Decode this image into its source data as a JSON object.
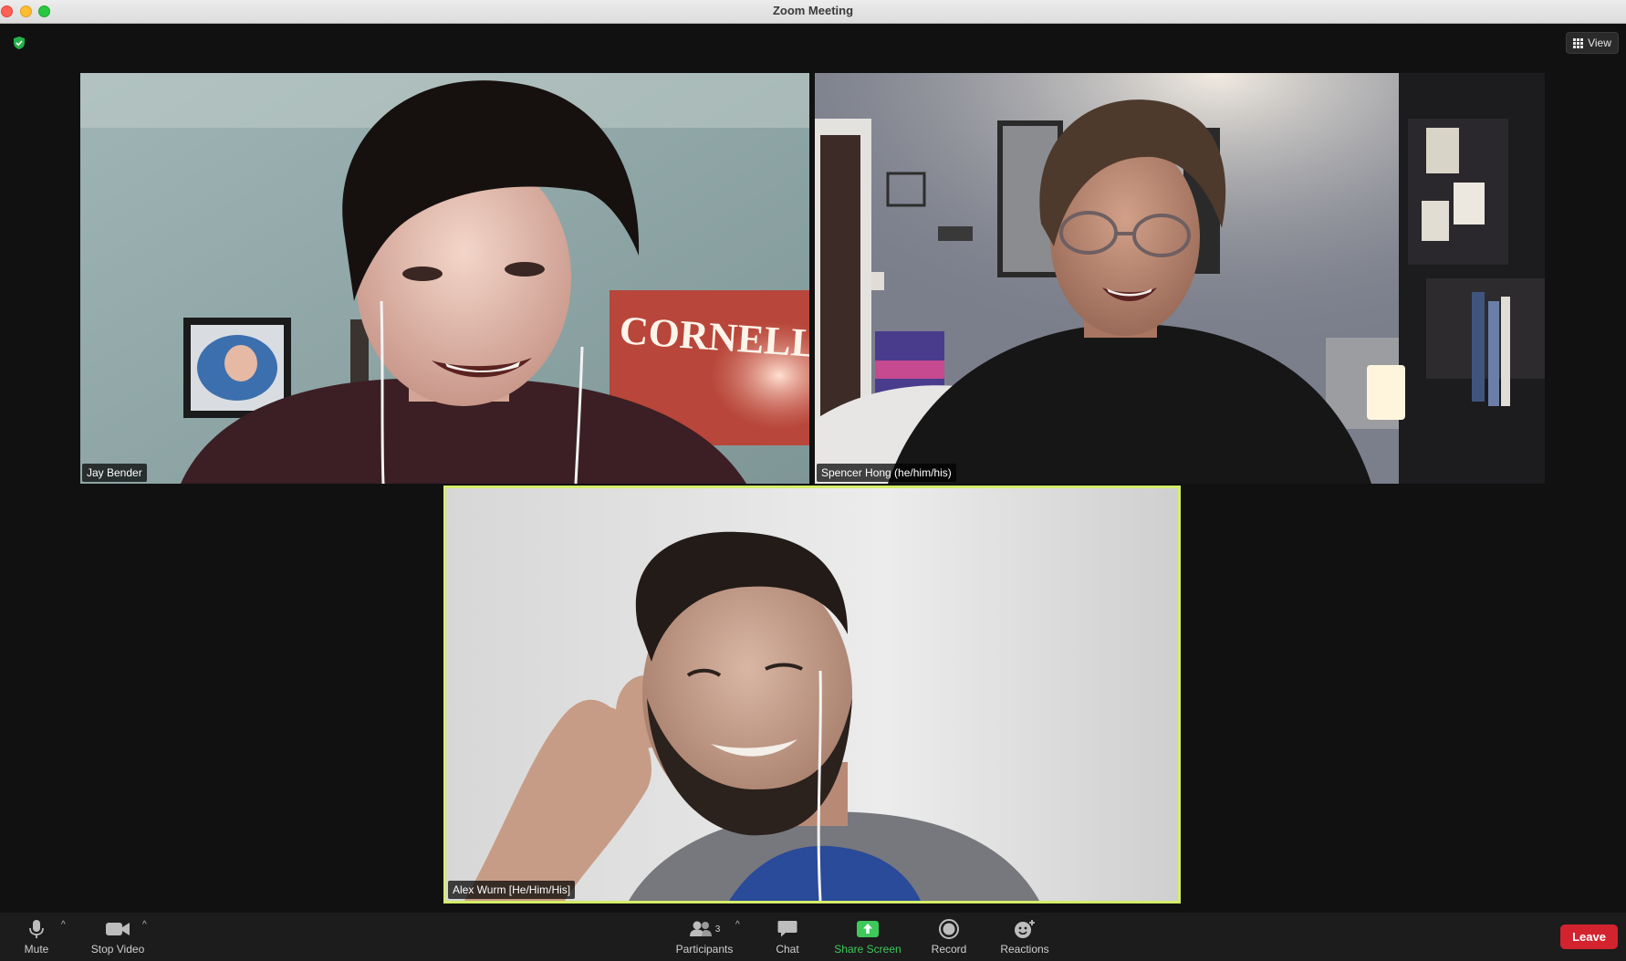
{
  "window": {
    "title": "Zoom Meeting"
  },
  "top_bar": {
    "view_label": "View"
  },
  "participants": [
    {
      "name": "Jay Bender"
    },
    {
      "name": "Spencer Hong (he/him/his)"
    },
    {
      "name": "Alex Wurm [He/Him/His]"
    }
  ],
  "scene_text": {
    "banner": "CORNELL"
  },
  "toolbar": {
    "mute_label": "Mute",
    "stop_video_label": "Stop Video",
    "participants_label": "Participants",
    "participants_count": "3",
    "chat_label": "Chat",
    "share_screen_label": "Share Screen",
    "record_label": "Record",
    "reactions_label": "Reactions",
    "leave_label": "Leave"
  },
  "colors": {
    "active_speaker_border": "#d5ee6a",
    "share_green": "#3ec95a",
    "leave_red": "#d3232e",
    "encryption_shield": "#23b04a"
  }
}
